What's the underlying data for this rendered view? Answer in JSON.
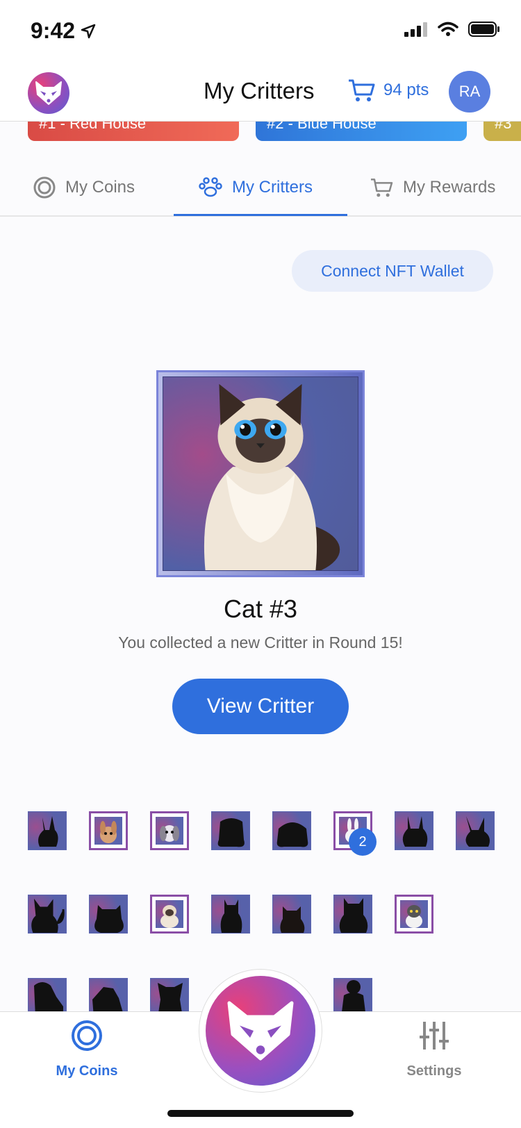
{
  "status_bar": {
    "time": "9:42"
  },
  "header": {
    "title": "My Critters",
    "points": "94 pts",
    "avatar_initials": "RA"
  },
  "houses": [
    {
      "label": "#1 - Red House",
      "color": "#e05a4c"
    },
    {
      "label": "#2 - Blue House",
      "color": "#3a8ee8"
    },
    {
      "label": "#3",
      "color": "#c9b04a"
    }
  ],
  "tabs": [
    {
      "label": "My Coins",
      "icon": "coin-ring-icon"
    },
    {
      "label": "My Critters",
      "icon": "paw-icon"
    },
    {
      "label": "My Rewards",
      "icon": "cart-icon"
    }
  ],
  "nft_button": "Connect NFT Wallet",
  "featured": {
    "name": "Cat #3",
    "subtitle": "You collected a new Critter in Round 15!",
    "button": "View Critter"
  },
  "collection_badge": "2",
  "bottom_nav": {
    "left": "My Coins",
    "right": "Settings"
  },
  "colors": {
    "accent": "#2f6fdd",
    "owned_border": "#8a4ea6"
  }
}
